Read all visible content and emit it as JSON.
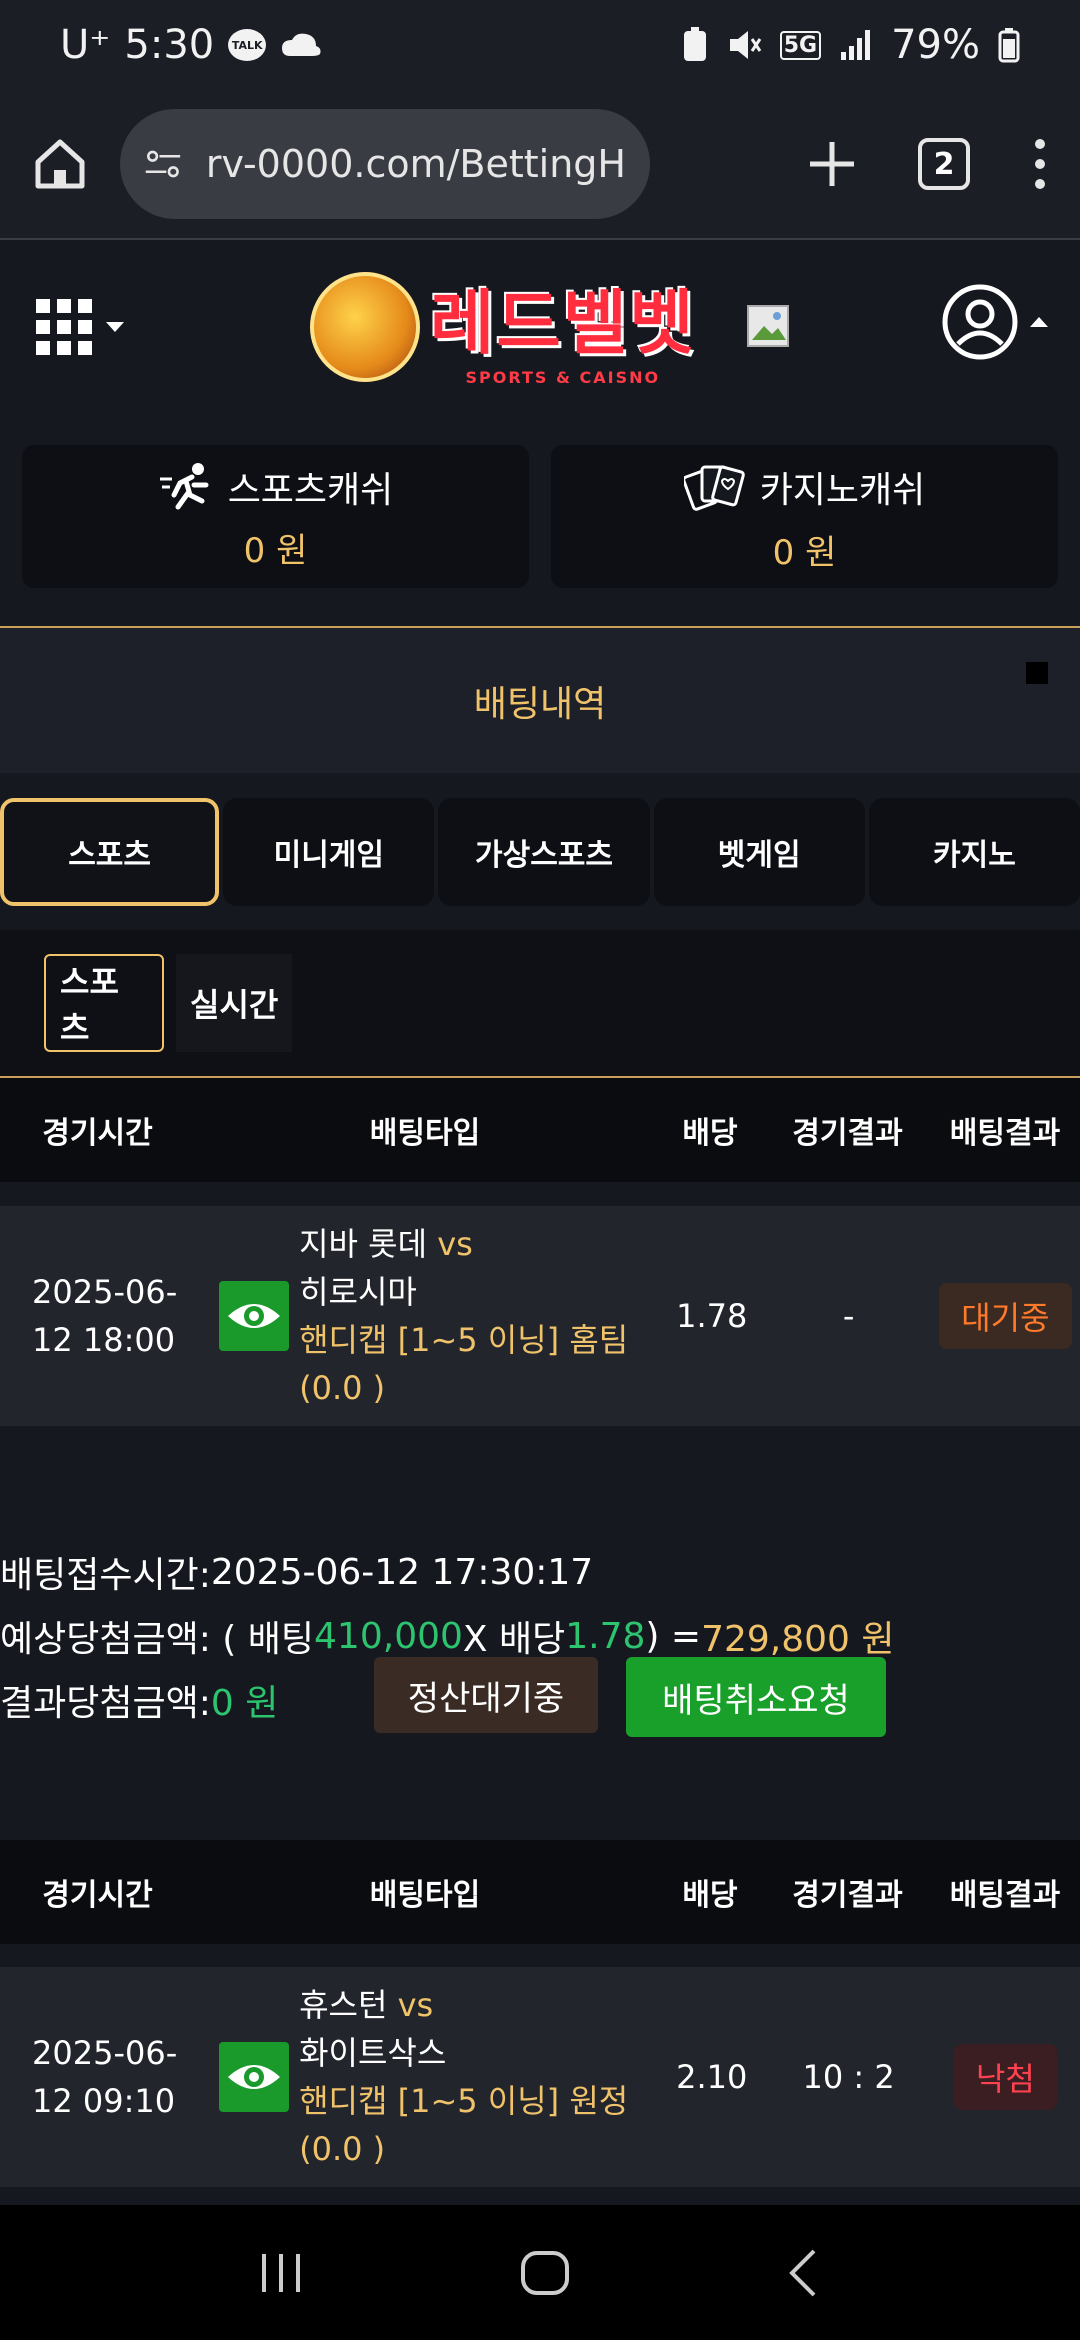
{
  "status_bar": {
    "carrier": "U⁺",
    "time": "5:30",
    "talk_label": "TALK",
    "network": "5G",
    "battery": "79%"
  },
  "browser": {
    "url": "rv-0000.com/BettingH",
    "tab_count": "2"
  },
  "site": {
    "logo_title": "레드벨벳",
    "logo_subtitle": "SPORTS & CAISNO"
  },
  "cash": [
    {
      "label": "스포츠캐쉬",
      "amount": "0 원"
    },
    {
      "label": "카지노캐쉬",
      "amount": "0 원"
    }
  ],
  "section_title": "배팅내역",
  "tabs": [
    {
      "label": "스포츠",
      "active": true
    },
    {
      "label": "미니게임",
      "active": false
    },
    {
      "label": "가상스포츠",
      "active": false
    },
    {
      "label": "벳게임",
      "active": false
    },
    {
      "label": "카지노",
      "active": false
    }
  ],
  "subtabs": [
    {
      "label": "스포츠",
      "active": true
    },
    {
      "label": "실시간",
      "active": false
    }
  ],
  "table_headers": [
    "경기시간",
    "배팅타입",
    "배당",
    "경기결과",
    "배팅결과"
  ],
  "bets": [
    {
      "time_line1": "2025-06-",
      "time_line2": "12 18:00",
      "home": "지바 롯데",
      "vs": "vs",
      "away": "히로시마",
      "market": "핸디캡 [1~5 이닝] 홈팀",
      "line": "(0.0 )",
      "odds": "1.78",
      "result": "-",
      "status": "대기중"
    },
    {
      "time_line1": "2025-06-",
      "time_line2": "12 09:10",
      "home": "휴스턴",
      "vs": "vs",
      "away": "화이트삭스",
      "market": "핸디캡 [1~5 이닝] 원정",
      "line": "(0.0 )",
      "odds": "2.10",
      "result": "10 : 2",
      "status": "낙첨"
    }
  ],
  "slip": {
    "received_label": "배팅접수시간: ",
    "received_time": "2025-06-12 17:30:17",
    "expected_label": "예상당첨금액: ( 배팅 ",
    "stake": "410,000",
    "times_label": " X 배당 ",
    "odds": "1.78",
    "equals_label": " ) = ",
    "payout": "729,800 원",
    "result_label": "결과당첨금액: ",
    "result_amount": "0 원",
    "pending_button": "정산대기중",
    "cancel_button": "배팅취소요청"
  },
  "colors": {
    "accent_gold": "#f0c36a",
    "green": "#2cc46e",
    "button_green": "#19a02a",
    "waiting_orange": "#ff7a2a",
    "lose_red": "#ff4250"
  }
}
